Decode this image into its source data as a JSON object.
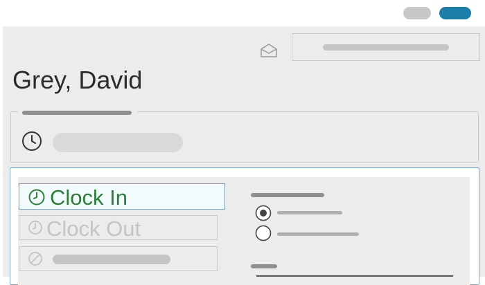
{
  "header": {
    "employee_name": "Grey, David",
    "mail_icon": "envelope-open-icon"
  },
  "time_section": {
    "icon": "clock-icon"
  },
  "actions": {
    "clock_in_label": "Clock In",
    "clock_in_icon": "clock-icon",
    "clock_out_label": "Clock Out",
    "clock_out_icon": "clock-icon",
    "third_icon": "ban-icon"
  },
  "options": {
    "radio_1_selected": true,
    "radio_2_selected": false
  },
  "colors": {
    "accent_blue": "#1a7ea8",
    "clock_in_green": "#2e7d3a",
    "disabled_text": "#c4c4c4",
    "panel_border": "#7ba7c6"
  }
}
